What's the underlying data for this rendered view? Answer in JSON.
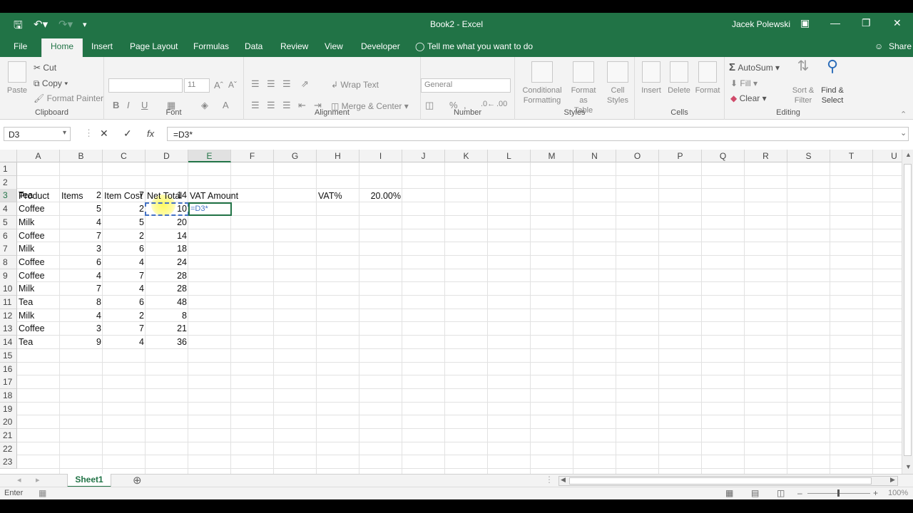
{
  "titlebar": {
    "title": "Book2 - Excel",
    "user": "Jacek Polewski"
  },
  "tabs": [
    "File",
    "Home",
    "Insert",
    "Page Layout",
    "Formulas",
    "Data",
    "Review",
    "View",
    "Developer"
  ],
  "tellme": "Tell me what you want to do",
  "share": "Share",
  "ribbon": {
    "clipboard": {
      "paste": "Paste",
      "cut": "Cut",
      "copy": "Copy",
      "painter": "Format Painter",
      "label": "Clipboard"
    },
    "font": {
      "size": "11",
      "label": "Font",
      "bold": "B",
      "italic": "I",
      "underline": "U"
    },
    "alignment": {
      "wrap": "Wrap Text",
      "merge": "Merge & Center",
      "label": "Alignment"
    },
    "number": {
      "format": "General",
      "percent": "%",
      "label": "Number"
    },
    "styles": {
      "cond1": "Conditional",
      "cond2": "Formatting",
      "table1": "Format as",
      "table2": "Table",
      "cell1": "Cell",
      "cell2": "Styles",
      "label": "Styles"
    },
    "cells": {
      "insert": "Insert",
      "delete": "Delete",
      "format": "Format",
      "label": "Cells"
    },
    "editing": {
      "autosum": "AutoSum",
      "fill": "Fill",
      "clear": "Clear",
      "sort1": "Sort &",
      "sort2": "Filter",
      "find1": "Find &",
      "find2": "Select",
      "label": "Editing"
    }
  },
  "formula_bar": {
    "name": "D3",
    "formula": "=D3*"
  },
  "columns": [
    "A",
    "B",
    "C",
    "D",
    "E",
    "F",
    "G",
    "H",
    "I",
    "J",
    "K",
    "L",
    "M",
    "N",
    "O",
    "P",
    "Q",
    "R",
    "S",
    "T",
    "U"
  ],
  "rows": [
    "1",
    "2",
    "3",
    "4",
    "5",
    "6",
    "7",
    "8",
    "9",
    "10",
    "11",
    "12",
    "13",
    "14",
    "15",
    "16",
    "17",
    "18",
    "19",
    "20",
    "21",
    "22",
    "23"
  ],
  "headers": {
    "a": "Product",
    "b": "Items",
    "c": "Item Cost",
    "d": "Net Total",
    "e": "VAT Amount",
    "h": "VAT%",
    "i": "20.00%"
  },
  "data": [
    {
      "product": "Tea",
      "items": "2",
      "cost": "7",
      "net": "14"
    },
    {
      "product": "Coffee",
      "items": "5",
      "cost": "2",
      "net": "10"
    },
    {
      "product": "Milk",
      "items": "4",
      "cost": "5",
      "net": "20"
    },
    {
      "product": "Coffee",
      "items": "7",
      "cost": "2",
      "net": "14"
    },
    {
      "product": "Milk",
      "items": "3",
      "cost": "6",
      "net": "18"
    },
    {
      "product": "Coffee",
      "items": "6",
      "cost": "4",
      "net": "24"
    },
    {
      "product": "Coffee",
      "items": "4",
      "cost": "7",
      "net": "28"
    },
    {
      "product": "Milk",
      "items": "7",
      "cost": "4",
      "net": "28"
    },
    {
      "product": "Tea",
      "items": "8",
      "cost": "6",
      "net": "48"
    },
    {
      "product": "Milk",
      "items": "4",
      "cost": "2",
      "net": "8"
    },
    {
      "product": "Coffee",
      "items": "3",
      "cost": "7",
      "net": "21"
    },
    {
      "product": "Tea",
      "items": "9",
      "cost": "4",
      "net": "36"
    }
  ],
  "editing_cell": "=D3*",
  "sheet": "Sheet1",
  "status": {
    "mode": "Enter",
    "zoom": "100%"
  },
  "colors": {
    "excel_green": "#217346",
    "ref_blue": "#4472c4"
  }
}
